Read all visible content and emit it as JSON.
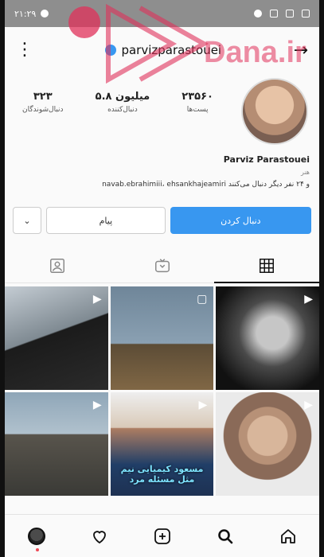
{
  "status_bar": {
    "time": "۲۱:۲۹"
  },
  "watermark": {
    "text": "Dana.ir"
  },
  "topbar": {
    "menu_icon": "more-vertical-icon",
    "username": "parvizparastouei",
    "back_icon": "arrow-right-icon"
  },
  "profile": {
    "stats": [
      {
        "value": "۲۳۵۶۰",
        "label": "پست‌ها"
      },
      {
        "value": "۵.۸ میلیون",
        "label": "دنبال‌کننده"
      },
      {
        "value": "۳۲۳",
        "label": "دنبال‌شوندگان"
      }
    ],
    "name": "Parviz Parastouei",
    "subtitle": "هنر",
    "followed_by": "navab.ebrahimiii، ehsankhajeamiri و ۲۴ نفر دیگر دنبال می‌کنند"
  },
  "actions": {
    "dropdown": "⌄",
    "message": "پیام",
    "follow": "دنبال کردن"
  },
  "tabs": [
    {
      "name": "tagged",
      "icon": "person-tag-icon"
    },
    {
      "name": "igtv",
      "icon": "tv-icon"
    },
    {
      "name": "grid",
      "icon": "grid-icon"
    }
  ],
  "grid": {
    "overlay_text": "مسعود کیمیایی نیم مثل \n مسئله مرد"
  },
  "bottom_nav": [
    {
      "name": "profile",
      "icon": "avatar-icon"
    },
    {
      "name": "activity",
      "icon": "heart-icon"
    },
    {
      "name": "new-post",
      "icon": "plus-square-icon"
    },
    {
      "name": "search",
      "icon": "search-icon"
    },
    {
      "name": "home",
      "icon": "home-icon"
    }
  ],
  "colors": {
    "accent": "#3897f0",
    "background": "#fafafa",
    "watermark": "#e0305a"
  }
}
